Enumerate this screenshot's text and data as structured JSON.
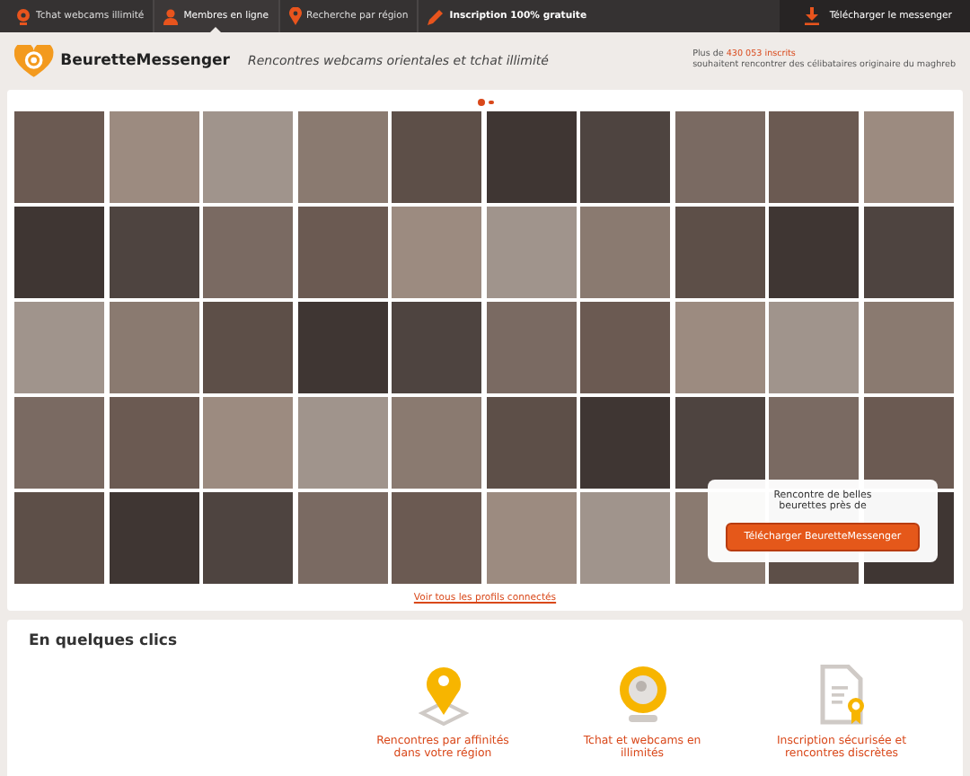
{
  "topbar": {
    "items": [
      {
        "label": "Tchat webcams illimité",
        "kind": "webcam",
        "selected": false,
        "bold": false
      },
      {
        "label": "Membres en ligne",
        "kind": "person",
        "selected": true,
        "bold": false
      },
      {
        "label": "Recherche par région",
        "kind": "pin",
        "selected": false,
        "bold": false
      },
      {
        "label": "Inscription 100% gratuite",
        "kind": "pencil",
        "selected": false,
        "bold": true
      }
    ],
    "download": "Télécharger le messenger"
  },
  "header": {
    "logo": "BeuretteMessenger",
    "tagline": "Rencontres webcams orientales et tchat illimité",
    "stats_prefix": "Plus de",
    "stats_count": "430 053 inscrits",
    "stats_text": "souhaitent rencontrer des célibataires originaire du maghreb"
  },
  "carousel_dots": [
    {
      "selected": true
    },
    {
      "selected": false
    }
  ],
  "popup": {
    "text": "Rencontre de belles beurettes près de",
    "button": "Télécharger BeuretteMessenger"
  },
  "profiles_link": "Voir tous les profils connectés",
  "features": {
    "title": "En quelques clics",
    "items": [
      {
        "kind": "pin",
        "label": "Rencontres par affinités dans votre région"
      },
      {
        "kind": "webcam",
        "label": "Tchat et webcams en illimités"
      },
      {
        "kind": "certificate",
        "label": "Inscription sécurisée et rencontres discrètes"
      }
    ]
  }
}
